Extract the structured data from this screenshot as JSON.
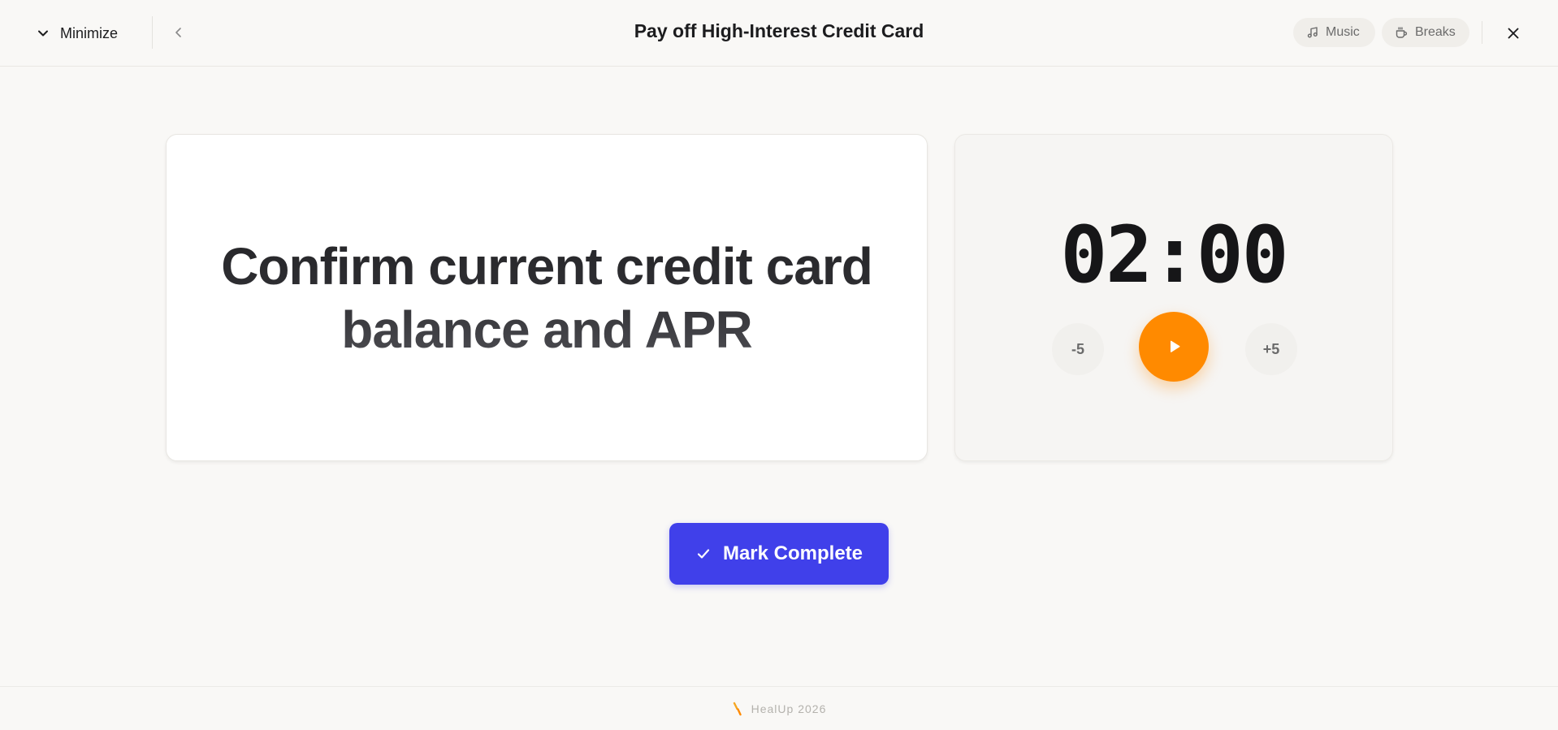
{
  "header": {
    "minimize_label": "Minimize",
    "title": "Pay off High-Interest Credit Card",
    "music_label": "Music",
    "breaks_label": "Breaks"
  },
  "task": {
    "line1": "Confirm current credit card",
    "line2": "balance and APR"
  },
  "timer": {
    "minutes": "02",
    "separator": ":",
    "seconds": "00",
    "minus_label": "-5",
    "plus_label": "+5"
  },
  "actions": {
    "mark_complete_label": "Mark Complete"
  },
  "footer": {
    "brand_text": "HealUp 2026"
  },
  "colors": {
    "accent_orange": "#ff8a00",
    "primary_blue": "#4040ea",
    "background": "#f9f8f6"
  },
  "icons": {
    "minimize": "chevron-down-icon",
    "back": "chevron-left-icon",
    "music": "music-note-icon",
    "breaks": "coffee-cup-icon",
    "close": "close-icon",
    "play": "play-icon",
    "check": "check-icon",
    "logo": "brand-logo-icon"
  }
}
